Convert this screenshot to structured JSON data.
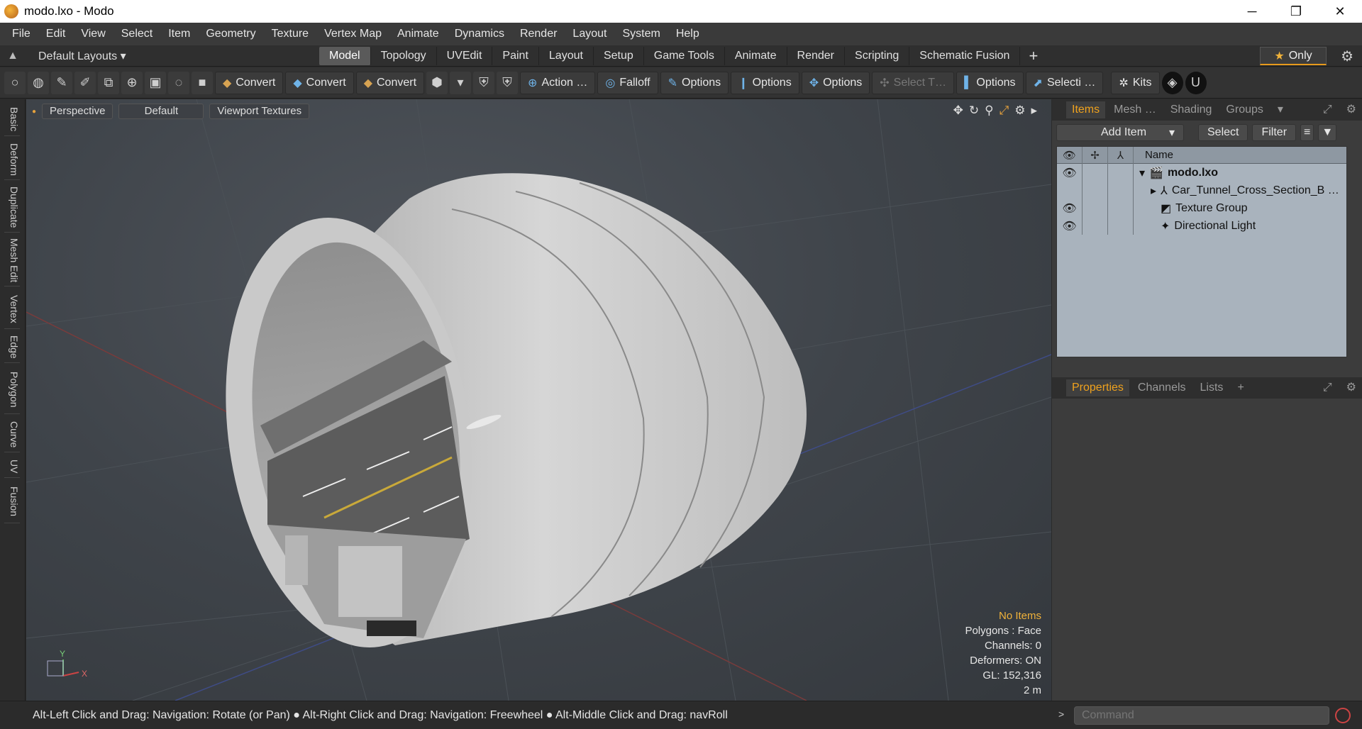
{
  "window": {
    "title": "modo.lxo - Modo",
    "controls": [
      "─",
      "❐",
      "✕"
    ]
  },
  "menu": [
    "File",
    "Edit",
    "View",
    "Select",
    "Item",
    "Geometry",
    "Texture",
    "Vertex Map",
    "Animate",
    "Dynamics",
    "Render",
    "Layout",
    "System",
    "Help"
  ],
  "layouts": {
    "label": "Default Layouts ▾"
  },
  "tabs": [
    "Model",
    "Topology",
    "UVEdit",
    "Paint",
    "Layout",
    "Setup",
    "Game Tools",
    "Animate",
    "Render",
    "Scripting",
    "Schematic Fusion"
  ],
  "active_tab": "Model",
  "only_label": "Only",
  "toolbar": {
    "convert1": "Convert",
    "convert2": "Convert",
    "convert3": "Convert",
    "action": "Action …",
    "falloff": "Falloff",
    "options1": "Options",
    "options2": "Options",
    "options3": "Options",
    "select_t": "Select T…",
    "options4": "Options",
    "selecti": "Selecti …",
    "kits": "Kits"
  },
  "side_tabs": [
    "Basic",
    "Deform",
    "Duplicate",
    "Mesh Edit",
    "Vertex",
    "Edge",
    "Polygon",
    "Curve",
    "UV",
    "Fusion"
  ],
  "viewport": {
    "view": "Perspective",
    "style": "Default",
    "textures": "Viewport Textures",
    "info": {
      "selection": "No Items",
      "polygons": "Polygons : Face",
      "channels": "Channels: 0",
      "deformers": "Deformers: ON",
      "gl": "GL: 152,316",
      "scale": "2 m"
    },
    "axis_labels": {
      "y": "Y",
      "x": "X"
    }
  },
  "items_panel": {
    "tabs": [
      "Items",
      "Mesh …",
      "Shading",
      "Groups"
    ],
    "add_item": "Add Item",
    "select": "Select",
    "filter": "Filter",
    "col_name": "Name",
    "rows": [
      {
        "name": "modo.lxo",
        "icon": "scene-icon",
        "bold": true
      },
      {
        "name": "Car_Tunnel_Cross_Section_B …",
        "icon": "mesh-icon"
      },
      {
        "name": "Texture Group",
        "icon": "texture-group-icon"
      },
      {
        "name": "Directional Light",
        "icon": "light-icon"
      }
    ]
  },
  "props_panel": {
    "tabs": [
      "Properties",
      "Channels",
      "Lists",
      "+"
    ]
  },
  "status": {
    "hint": "Alt-Left Click and Drag: Navigation: Rotate (or Pan) ● Alt-Right Click and Drag: Navigation: Freewheel ● Alt-Middle Click and Drag: navRoll",
    "command_placeholder": "Command"
  }
}
